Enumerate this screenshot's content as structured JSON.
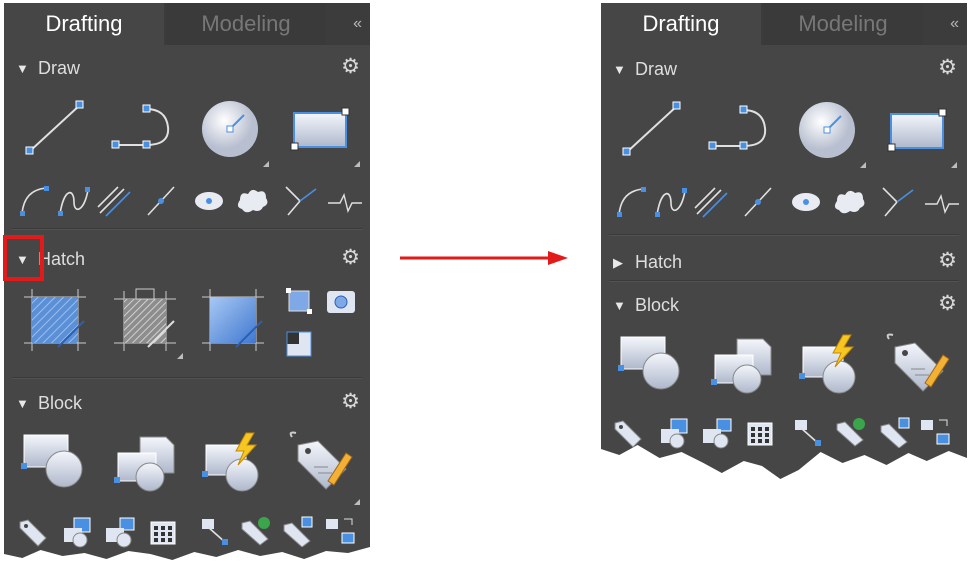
{
  "left_panel": {
    "tabs": [
      "Drafting",
      "Modeling"
    ],
    "collapse": "«",
    "sections": [
      {
        "expanded_glyph": "▼",
        "label": "Draw"
      },
      {
        "expanded_glyph": "▼",
        "label": "Hatch"
      },
      {
        "expanded_glyph": "▼",
        "label": "Block"
      }
    ]
  },
  "right_panel": {
    "tabs": [
      "Drafting",
      "Modeling"
    ],
    "collapse": "«",
    "sections": [
      {
        "expanded_glyph": "▼",
        "label": "Draw"
      },
      {
        "expanded_glyph": "▶",
        "label": "Hatch"
      },
      {
        "expanded_glyph": "▼",
        "label": "Block"
      }
    ]
  },
  "icons": {
    "draw_large": [
      "line-icon",
      "polyline-icon",
      "circle-icon",
      "rectangle-icon"
    ],
    "draw_small": [
      "arc-icon",
      "spline-icon",
      "multiline-icon",
      "construction-line-icon",
      "ellipse-icon",
      "revision-cloud-icon",
      "ray-icon",
      "break-line-icon"
    ],
    "hatch": [
      "hatch-icon",
      "gradient-icon",
      "boundary-icon",
      "region-icon",
      "wipeout-icon",
      "cover-icon"
    ],
    "block_large": [
      "create-block-icon",
      "insert-block-icon",
      "dynamic-block-icon",
      "edit-attribute-icon"
    ],
    "block_small": [
      "define-attribute-icon",
      "block-editor-icon",
      "write-block-icon",
      "table-icon",
      "base-point-icon",
      "edit-reference-icon",
      "attribute-sync-icon",
      "attribute-manager-icon"
    ],
    "gear": "gear-icon"
  },
  "colors": {
    "panel_bg": "#464646",
    "accent_blue": "#4a90e2",
    "highlight_red": "#e21a1a"
  }
}
